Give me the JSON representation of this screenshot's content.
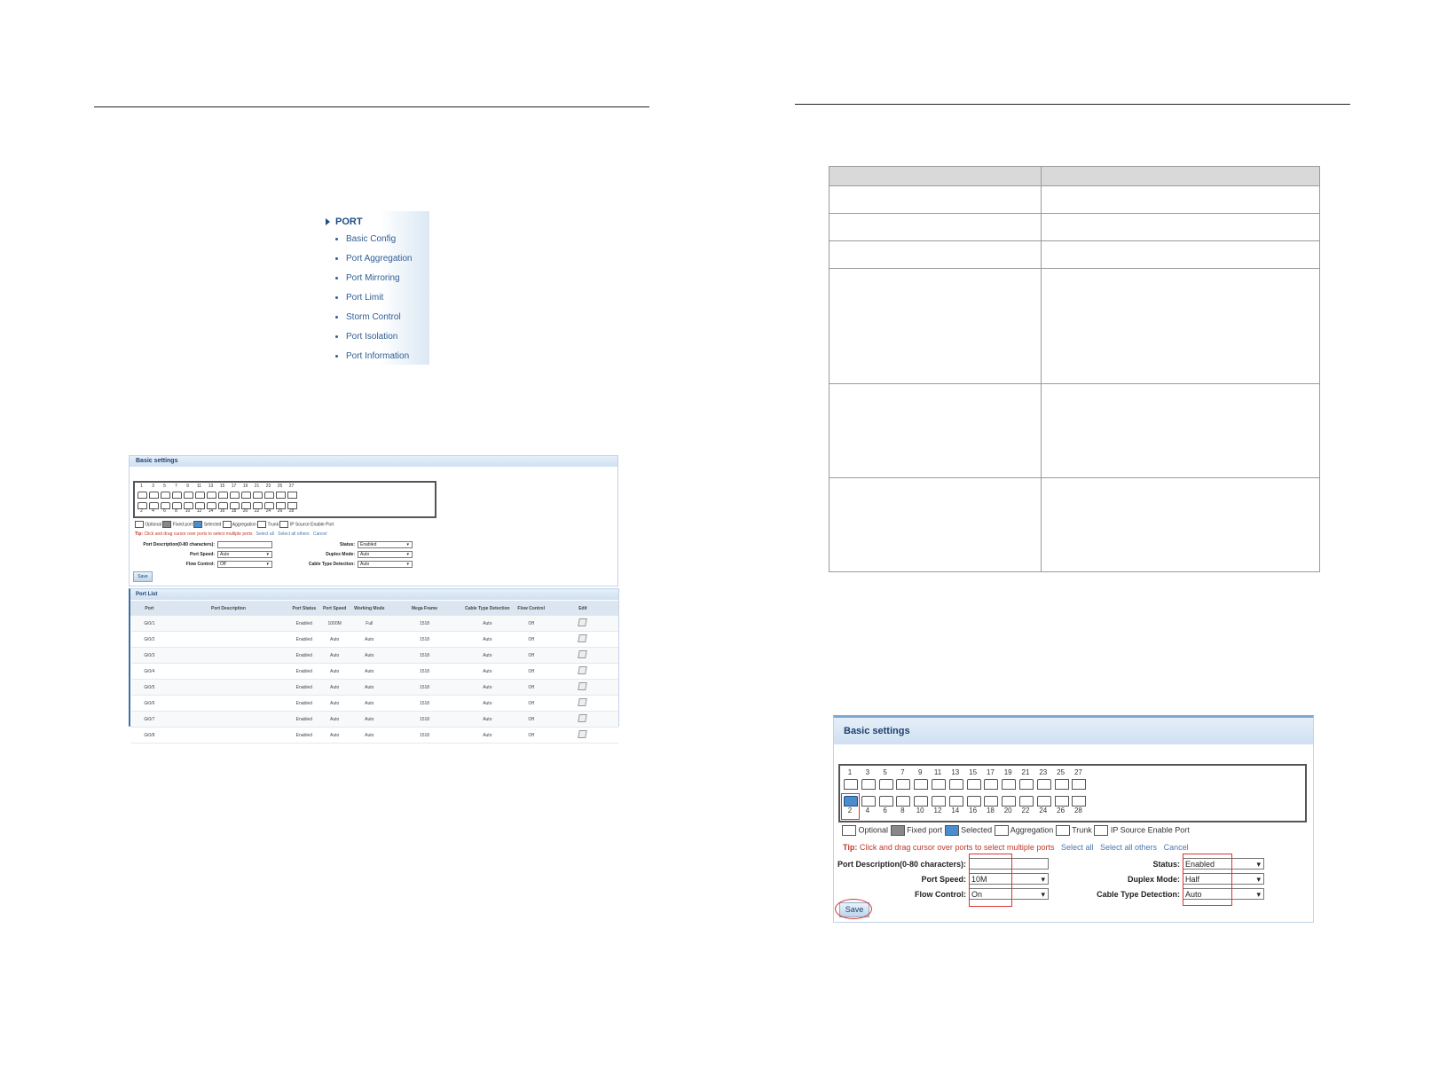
{
  "menu": {
    "title": "PORT",
    "items": [
      "Basic Config",
      "Port Aggregation",
      "Port Mirroring",
      "Port Limit",
      "Storm Control",
      "Port Isolation",
      "Port Information"
    ]
  },
  "small_panel": {
    "title": "Basic settings",
    "top_numbers": [
      "1",
      "3",
      "5",
      "7",
      "9",
      "11",
      "13",
      "15",
      "17",
      "19",
      "21",
      "23",
      "25",
      "27"
    ],
    "bottom_numbers": [
      "2",
      "4",
      "6",
      "8",
      "10",
      "12",
      "14",
      "16",
      "18",
      "20",
      "22",
      "24",
      "26",
      "28"
    ],
    "legend": [
      "Optional",
      "Fixed port",
      "Selected",
      "Aggregation",
      "Trunk",
      "IP Source Enable Port"
    ],
    "tip_label": "Tip:",
    "tip_text": "Click and drag cursor over ports to select multiple ports",
    "select_all": "Select all",
    "select_all_others": "Select all others",
    "cancel": "Cancel",
    "port_description_label": "Port Description(0-80 characters):",
    "port_speed_label": "Port Speed:",
    "port_speed_value": "Auto",
    "flow_control_label": "Flow Control:",
    "flow_control_value": "Off",
    "status_label": "Status:",
    "status_value": "Enabled",
    "duplex_label": "Duplex Mode:",
    "duplex_value": "Auto",
    "cable_label": "Cable Type Detection:",
    "cable_value": "Auto",
    "save": "Save"
  },
  "port_list": {
    "title": "Port List",
    "columns": [
      "Port",
      "Port Description",
      "Port Status",
      "Port Speed",
      "Working Mode",
      "Mega Frame",
      "Cable Type Detection",
      "Flow Control",
      "Edit"
    ],
    "rows": [
      [
        "Gi0/1",
        "",
        "Enabled",
        "1000M",
        "Full",
        "1518",
        "Auto",
        "Off"
      ],
      [
        "Gi0/2",
        "",
        "Enabled",
        "Auto",
        "Auto",
        "1518",
        "Auto",
        "Off"
      ],
      [
        "Gi0/3",
        "",
        "Enabled",
        "Auto",
        "Auto",
        "1518",
        "Auto",
        "Off"
      ],
      [
        "Gi0/4",
        "",
        "Enabled",
        "Auto",
        "Auto",
        "1518",
        "Auto",
        "Off"
      ],
      [
        "Gi0/5",
        "",
        "Enabled",
        "Auto",
        "Auto",
        "1518",
        "Auto",
        "Off"
      ],
      [
        "Gi0/6",
        "",
        "Enabled",
        "Auto",
        "Auto",
        "1518",
        "Auto",
        "Off"
      ],
      [
        "Gi0/7",
        "",
        "Enabled",
        "Auto",
        "Auto",
        "1518",
        "Auto",
        "Off"
      ],
      [
        "Gi0/8",
        "",
        "Enabled",
        "Auto",
        "Auto",
        "1518",
        "Auto",
        "Off"
      ]
    ]
  },
  "large_panel": {
    "title": "Basic settings",
    "legend": [
      "Optional",
      "Fixed port",
      "Selected",
      "Aggregation",
      "Trunk",
      "IP Source Enable Port"
    ],
    "tip_label": "Tip:",
    "tip_text": "Click and drag cursor over ports to select multiple ports",
    "select_all": "Select all",
    "select_all_others": "Select all others",
    "cancel": "Cancel",
    "port_description_label": "Port Description(0-80 characters):",
    "port_speed_label": "Port Speed:",
    "port_speed_value": "10M",
    "flow_control_label": "Flow Control:",
    "flow_control_value": "On",
    "status_label": "Status:",
    "status_value": "Enabled",
    "duplex_label": "Duplex Mode:",
    "duplex_value": "Half",
    "cable_label": "Cable Type Detection:",
    "cable_value": "Auto",
    "save": "Save"
  },
  "colors": {
    "panel_bar": "#cfe0f1",
    "accent": "#1d3f6e",
    "tip": "#c0392b",
    "highlight": "#dd3333",
    "selected_port": "#4a8ccc"
  }
}
